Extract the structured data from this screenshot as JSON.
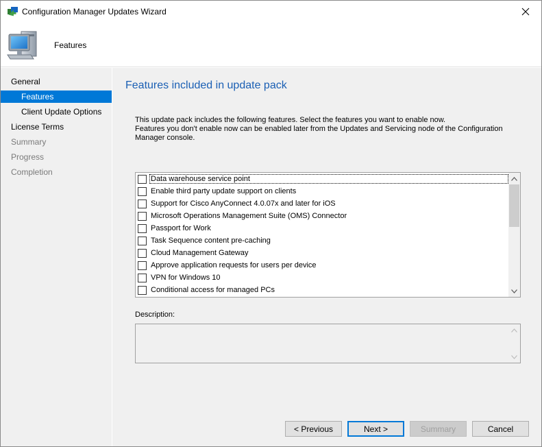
{
  "window": {
    "title": "Configuration Manager Updates Wizard",
    "header_title": "Features"
  },
  "nav": {
    "items": [
      {
        "label": "General",
        "state": "normal"
      },
      {
        "label": "Features",
        "state": "selected"
      },
      {
        "label": "Client Update Options",
        "state": "normal"
      },
      {
        "label": "License Terms",
        "state": "normal"
      },
      {
        "label": "Summary",
        "state": "disabled"
      },
      {
        "label": "Progress",
        "state": "disabled"
      },
      {
        "label": "Completion",
        "state": "disabled"
      }
    ]
  },
  "main": {
    "heading": "Features included in update pack",
    "intro_line1": "This update pack includes the following features. Select the features you want to enable now.",
    "intro_line2": "Features you don't enable now can be enabled later from the Updates and Servicing node of the Configuration Manager console.",
    "features": [
      {
        "label": "Data warehouse service point",
        "checked": false
      },
      {
        "label": "Enable third party update support on clients",
        "checked": false
      },
      {
        "label": "Support for Cisco AnyConnect 4.0.07x and later for iOS",
        "checked": false
      },
      {
        "label": "Microsoft Operations Management Suite (OMS) Connector",
        "checked": false
      },
      {
        "label": "Passport for Work",
        "checked": false
      },
      {
        "label": "Task Sequence content pre-caching",
        "checked": false
      },
      {
        "label": "Cloud Management Gateway",
        "checked": false
      },
      {
        "label": "Approve application requests for users per device",
        "checked": false
      },
      {
        "label": "VPN for Windows 10",
        "checked": false
      },
      {
        "label": "Conditional access for managed PCs",
        "checked": false
      }
    ],
    "description_label": "Description:",
    "description_value": ""
  },
  "footer": {
    "previous_label": "< Previous",
    "next_label": "Next >",
    "summary_label": "Summary",
    "cancel_label": "Cancel"
  },
  "colors": {
    "accent": "#0078d7",
    "heading": "#1a5fb4",
    "panel": "#f0f0f0"
  }
}
